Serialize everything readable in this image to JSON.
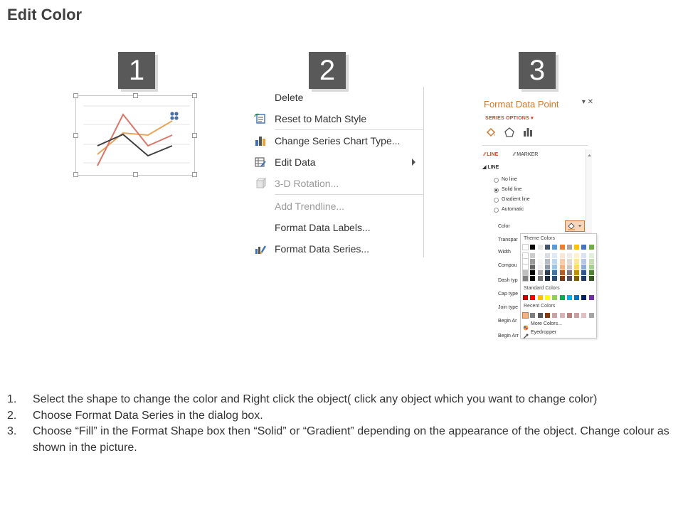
{
  "page": {
    "title": "Edit Color"
  },
  "badges": [
    "1",
    "2",
    "3"
  ],
  "context_menu": {
    "items": [
      {
        "label": "Delete",
        "icon": "none",
        "disabled": false
      },
      {
        "label": "Reset to Match Style",
        "icon": "reset-style-icon",
        "disabled": false
      },
      {
        "label": "Change Series Chart Type...",
        "icon": "bar-chart-icon",
        "disabled": false
      },
      {
        "label": "Edit Data",
        "icon": "edit-data-icon",
        "disabled": false,
        "submenu": true
      },
      {
        "label": "3-D Rotation...",
        "icon": "3d-rotation-icon",
        "disabled": true
      },
      {
        "label": "Add Trendline...",
        "icon": "none",
        "disabled": true
      },
      {
        "label": "Format Data Labels...",
        "icon": "none",
        "disabled": false
      },
      {
        "label": "Format Data Series...",
        "icon": "format-series-icon",
        "disabled": false
      }
    ]
  },
  "format_pane": {
    "title": "Format Data Point",
    "controls": "▾ ✕",
    "series_options": "SERIES OPTIONS ▾",
    "tabs": [
      "fill-line-icon",
      "effects-icon",
      "series-options-icon"
    ],
    "sub_tabs": {
      "line": "LINE",
      "marker": "MARKER"
    },
    "section": "LINE",
    "radios": [
      "No line",
      "Solid line",
      "Gradient line",
      "Automatic"
    ],
    "selected_radio": "Solid line",
    "rows": [
      "Color",
      "Transparency",
      "Width",
      "Compound type",
      "Dash type",
      "Cap type",
      "Join type",
      "Begin Arrow type",
      "Begin Arrow size"
    ],
    "rows_visible": [
      "Color",
      "Transpar",
      "Width",
      "Compou",
      "Dash typ",
      "Cap type",
      "Join type",
      "Begin Ar",
      "Begin Arr"
    ]
  },
  "palette": {
    "theme_label": "Theme Colors",
    "standard_label": "Standard Colors",
    "recent_label": "Recent Colors",
    "more_colors": "More Colors...",
    "eyedropper": "Eyedropper",
    "theme_top": [
      "#ffffff",
      "#000000",
      "#e7e6e6",
      "#44546a",
      "#5b9bd5",
      "#ed7d31",
      "#a5a5a5",
      "#ffc000",
      "#4472c4",
      "#70ad47"
    ],
    "standard": [
      "#c00000",
      "#ff0000",
      "#ffc000",
      "#ffff00",
      "#92d050",
      "#00b050",
      "#00b0f0",
      "#0070c0",
      "#002060",
      "#7030a0"
    ],
    "recent": [
      "#f4b183",
      "#7f7f7f",
      "#595959",
      "#843c0c",
      "#c9a4a4",
      "#d9b3b3",
      "#b98080",
      "#c8a0a0",
      "#e0c0c0",
      "#a5a5a5"
    ]
  },
  "accent_colors": {
    "chart_orange": "#e8a55a",
    "chart_red": "#d9786c",
    "chart_dark": "#404040",
    "pane_title": "#d0782e"
  },
  "instructions": [
    {
      "num": "1.",
      "text": "Select the shape to change the color and Right click the object( click any object which you want to change color)"
    },
    {
      "num": "2.",
      "text": "Choose Format Data Series in the dialog box."
    },
    {
      "num": "3.",
      "text": "Choose “Fill” in the Format Shape box then “Solid” or “Gradient” depending on the appearance of the object. Change colour as shown in the picture."
    }
  ]
}
